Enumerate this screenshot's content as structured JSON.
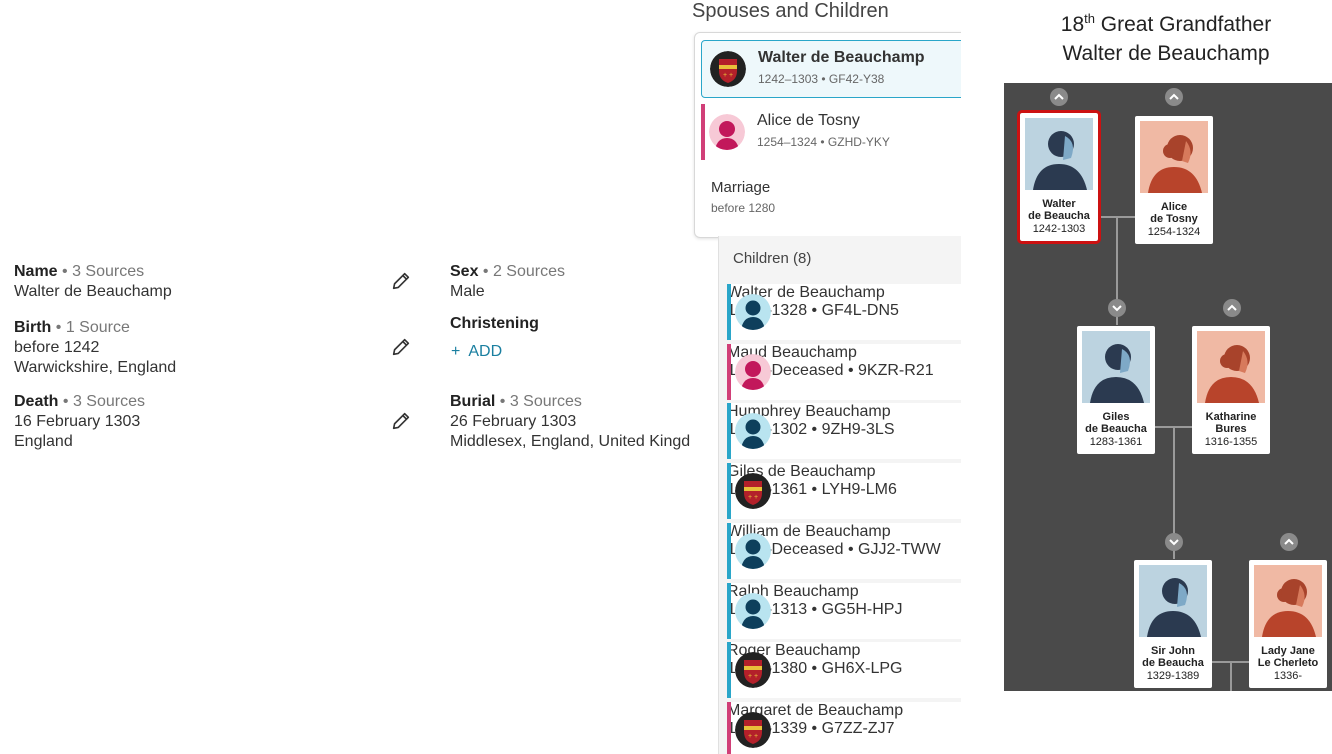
{
  "vitals": {
    "name": {
      "label": "Name",
      "sources": " • 3 Sources",
      "value": "Walter de Beauchamp"
    },
    "birth": {
      "label": "Birth",
      "sources": " • 1 Source",
      "date": "before 1242",
      "place": "Warwickshire, England"
    },
    "death": {
      "label": "Death",
      "sources": " • 3 Sources",
      "date": "16 February 1303",
      "place": "England"
    },
    "sex": {
      "label": "Sex",
      "sources": " • 2 Sources",
      "value": "Male"
    },
    "christening": {
      "label": "Christening",
      "add_label": "+  ADD"
    },
    "burial": {
      "label": "Burial",
      "sources": " • 3 Sources",
      "date": "26 February 1303",
      "place": "Middlesex, England, United Kingd"
    }
  },
  "spouses": {
    "title": "Spouses and Children",
    "husband": {
      "name": "Walter de Beauchamp",
      "dates": "1242–1303 •  GF42-Y38"
    },
    "wife": {
      "name": "Alice de Tosny",
      "dates": "1254–1324 •  GZHD-YKY"
    },
    "marriage_label": "Marriage",
    "marriage_date": "before 1280"
  },
  "children": {
    "title": "Children (8)",
    "items": [
      {
        "name": "Walter de Beauchamp",
        "dates": "1278–1328 •  GF4L-DN5",
        "avatar": "male-avatar-icon",
        "stripe": "#2aa6c9"
      },
      {
        "name": "Maud Beauchamp",
        "dates": "1280–Deceased •  9KZR-R21",
        "avatar": "female-avatar-icon",
        "stripe": "#d13f78"
      },
      {
        "name": "Humphrey Beauchamp",
        "dates": "1281–1302 •  9ZH9-3LS",
        "avatar": "male-avatar-icon",
        "stripe": "#2aa6c9"
      },
      {
        "name": "Giles de Beauchamp",
        "dates": "1283–1361 •  LYH9-LM6",
        "avatar": "coat-of-arms-icon",
        "stripe": "#2aa6c9"
      },
      {
        "name": "William de Beauchamp",
        "dates": "1285–Deceased •  GJJ2-TWW",
        "avatar": "male-avatar-icon",
        "stripe": "#2aa6c9"
      },
      {
        "name": "Ralph Beauchamp",
        "dates": "1288–1313 •  GG5H-HPJ",
        "avatar": "male-avatar-icon",
        "stripe": "#2aa6c9"
      },
      {
        "name": "Roger Beauchamp",
        "dates": "1290–1380 •  GH6X-LPG",
        "avatar": "coat-of-arms-icon",
        "stripe": "#2aa6c9"
      },
      {
        "name": "Margaret de Beauchamp",
        "dates": "1293–1339 •  G7ZZ-ZJ7",
        "avatar": "coat-of-arms-icon",
        "stripe": "#d13f78"
      }
    ]
  },
  "tree": {
    "heading_sup": "th",
    "heading_num": "18",
    "heading_rest": " Great Grandfather",
    "heading_name": "Walter de Beauchamp",
    "people": [
      {
        "line1": "Walter",
        "line2": "de Beaucha",
        "dates": "1242-1303",
        "sex": "male",
        "selected": true
      },
      {
        "line1": "Alice",
        "line2": "de Tosny",
        "dates": "1254-1324",
        "sex": "female",
        "selected": false
      },
      {
        "line1": "Giles",
        "line2": "de Beaucha",
        "dates": "1283-1361",
        "sex": "male",
        "selected": false
      },
      {
        "line1": "Katharine",
        "line2": "Bures",
        "dates": "1316-1355",
        "sex": "female",
        "selected": false
      },
      {
        "line1": "Sir John",
        "line2": "de Beaucha",
        "dates": "1329-1389",
        "sex": "male",
        "selected": false
      },
      {
        "line1": "Lady Jane",
        "line2": "Le Cherleto",
        "dates": "1336-",
        "sex": "female",
        "selected": false
      }
    ]
  },
  "colors": {
    "male": "#2aa6c9",
    "female": "#d13f78",
    "tree_bg": "#4a4a4a",
    "selected_border": "#cc1111"
  }
}
